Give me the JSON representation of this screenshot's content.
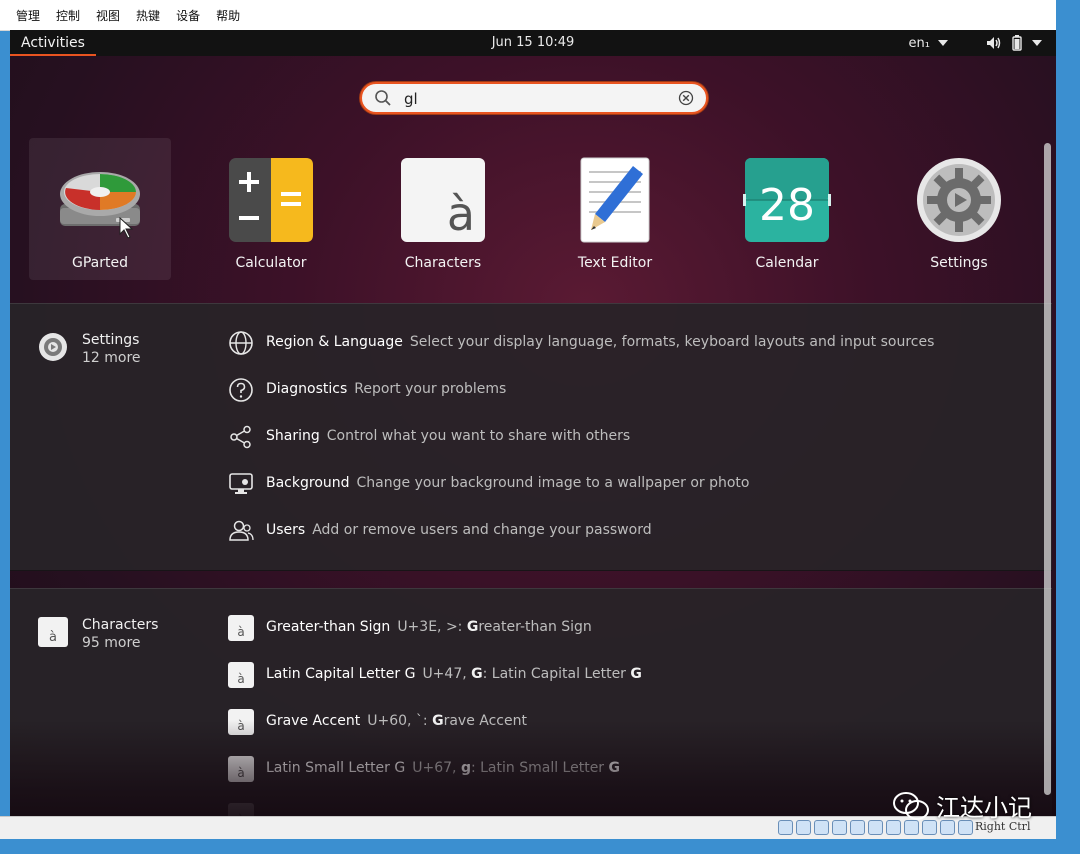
{
  "vbox_menu": [
    "管理",
    "控制",
    "视图",
    "热键",
    "设备",
    "帮助"
  ],
  "topbar": {
    "activities": "Activities",
    "clock": "Jun 15  10:49",
    "lang": "en₁"
  },
  "search": {
    "value": "gl",
    "placeholder": ""
  },
  "apps": [
    {
      "name": "GParted",
      "icon": "gparted-icon",
      "selected": true
    },
    {
      "name": "Calculator",
      "icon": "calculator-icon"
    },
    {
      "name": "Characters",
      "icon": "characters-icon"
    },
    {
      "name": "Text Editor",
      "icon": "text-editor-icon"
    },
    {
      "name": "Calendar",
      "icon": "calendar-icon",
      "day": "28"
    },
    {
      "name": "Settings",
      "icon": "settings-icon"
    }
  ],
  "settings_provider": {
    "name": "Settings",
    "more": "12 more",
    "results": [
      {
        "title": "Region & Language",
        "desc": "Select your display language, formats, keyboard layouts and input sources",
        "icon": "globe-icon"
      },
      {
        "title": "Diagnostics",
        "desc": "Report your problems",
        "icon": "help-icon"
      },
      {
        "title": "Sharing",
        "desc": "Control what you want to share with others",
        "icon": "share-icon"
      },
      {
        "title": "Background",
        "desc": "Change your background image to a wallpaper or photo",
        "icon": "display-icon"
      },
      {
        "title": "Users",
        "desc": "Add or remove users and change your password",
        "icon": "users-icon"
      }
    ]
  },
  "characters_provider": {
    "name": "Characters",
    "more": "95 more",
    "badge_glyph": "à",
    "results": [
      {
        "title": "Greater-than Sign",
        "code": "U+3E, >: ",
        "bold": "G",
        "rest": "reater-than Sign"
      },
      {
        "title": "Latin Capital Letter G",
        "code": "U+47, ",
        "bold": "G",
        "mid": ": Latin Capital Letter ",
        "bold2": "G"
      },
      {
        "title": "Grave Accent",
        "code": "U+60, `: ",
        "bold": "G",
        "rest": "rave Accent"
      },
      {
        "title": "Latin Small Letter G",
        "code": "U+67, ",
        "bold": "g",
        "mid": ": Latin Small Letter ",
        "bold2": "G"
      }
    ]
  },
  "statusbar": {
    "host_key": "Right Ctrl"
  },
  "watermark": "江达小记",
  "colors": {
    "accent": "#e95420",
    "panel": "#282428",
    "topbar": "#121212"
  }
}
